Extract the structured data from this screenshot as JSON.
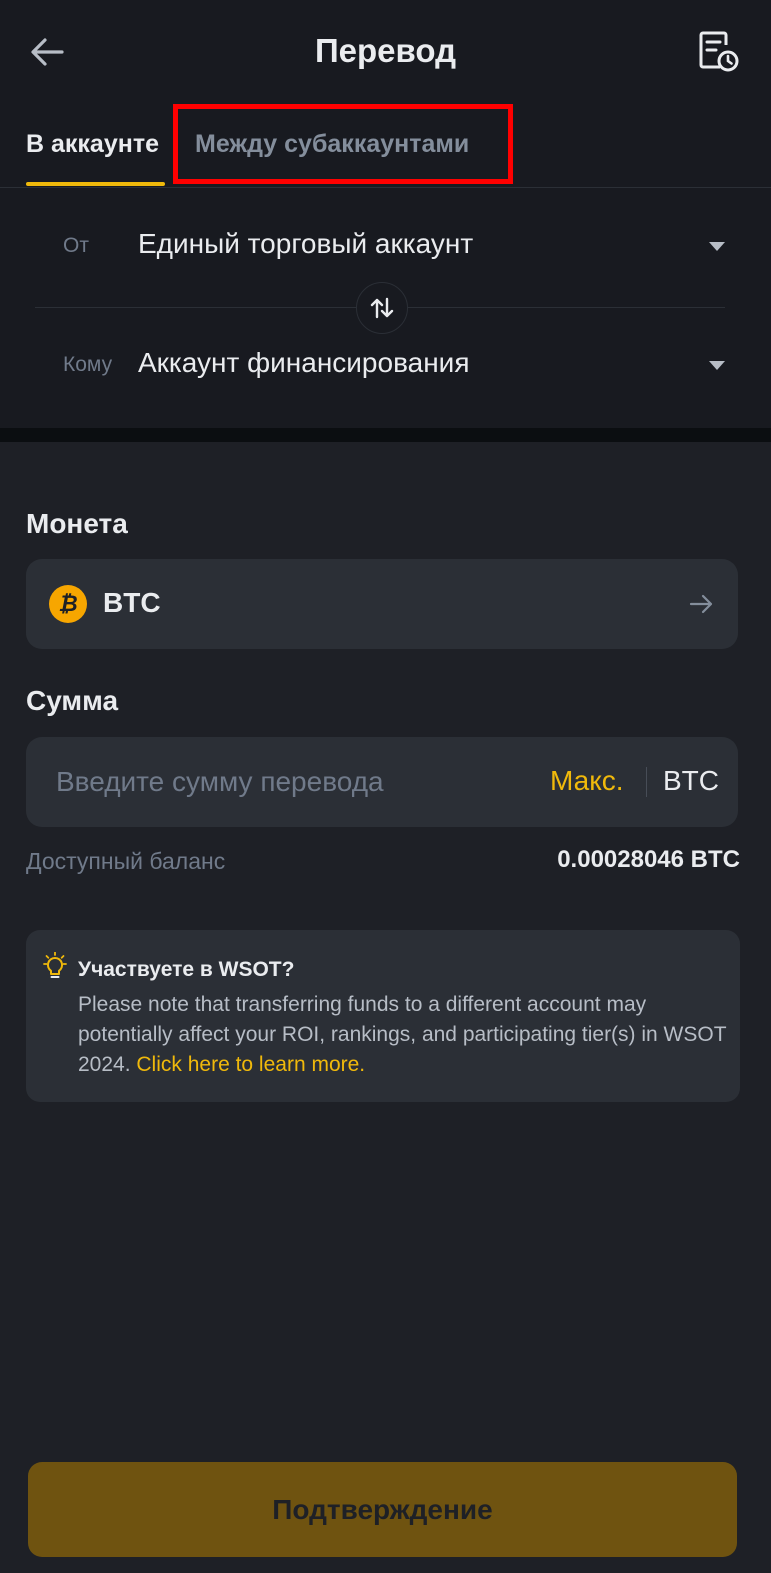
{
  "header": {
    "title": "Перевод",
    "back_icon": "arrow-left-icon",
    "history_icon": "history-document-icon"
  },
  "tabs": [
    {
      "label": "В аккаунте",
      "active": true
    },
    {
      "label": "Между субаккаунтами",
      "active": false
    }
  ],
  "transfer": {
    "from_label": "От",
    "from_value": "Единый торговый аккаунт",
    "to_label": "Кому",
    "to_value": "Аккаунт финансирования",
    "swap_icon": "swap-arrows-icon"
  },
  "coin": {
    "section_label": "Монета",
    "symbol": "BTC",
    "icon_glyph": "₿"
  },
  "amount": {
    "section_label": "Сумма",
    "placeholder": "Введите сумму перевода",
    "value": "",
    "max_label": "Макс.",
    "unit": "BTC"
  },
  "balance": {
    "label": "Доступный баланс",
    "value": "0.00028046 BTC"
  },
  "notice": {
    "title": "Участвуете в WSOT?",
    "text": "Please note that transferring funds to a different account may potentially affect your ROI, rankings, and participating tier(s) in WSOT 2024. ",
    "link": "Click here to learn more."
  },
  "confirm_label": "Подтверждение",
  "colors": {
    "accent": "#f0b90b",
    "background": "#181a20",
    "panel": "#2b2f36",
    "highlight_box": "#ff0000"
  }
}
